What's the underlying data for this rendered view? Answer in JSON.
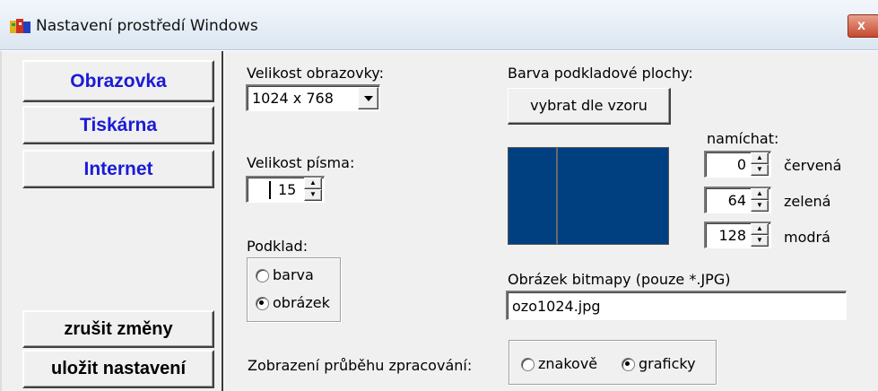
{
  "window": {
    "title": "Nastavení prostředí Windows",
    "close_glyph": "x"
  },
  "nav": {
    "obrazovka": "Obrazovka",
    "tiskarna": "Tiskárna",
    "internet": "Internet",
    "cancel": "zrušit změny",
    "save": "uložit nastavení"
  },
  "screen": {
    "size_label": "Velikost obrazovky:",
    "size_value": "1024 x 768",
    "font_label": "Velikost písma:",
    "font_value": "15"
  },
  "background": {
    "label": "Podklad:",
    "option_color": "barva",
    "option_image": "obrázek",
    "selected": "obrázek"
  },
  "desktop_color": {
    "label": "Barva podkladové plochy:",
    "pick_button": "vybrat dle vzoru",
    "mix_label": "namíchat:",
    "swatch_color": "#003f80",
    "red_value": "0",
    "red_label": "červená",
    "green_value": "64",
    "green_label": "zelená",
    "blue_value": "128",
    "blue_label": "modrá"
  },
  "bitmap": {
    "label": "Obrázek bitmapy (pouze *.JPG)",
    "value": "ozo1024.jpg"
  },
  "progress": {
    "label": "Zobrazení průběhu zpracování:",
    "option_char": "znakově",
    "option_graphic": "graficky",
    "selected": "graficky"
  },
  "colors": {
    "nav_accent": "#1b1bd6",
    "face": "#f0f0f0"
  }
}
